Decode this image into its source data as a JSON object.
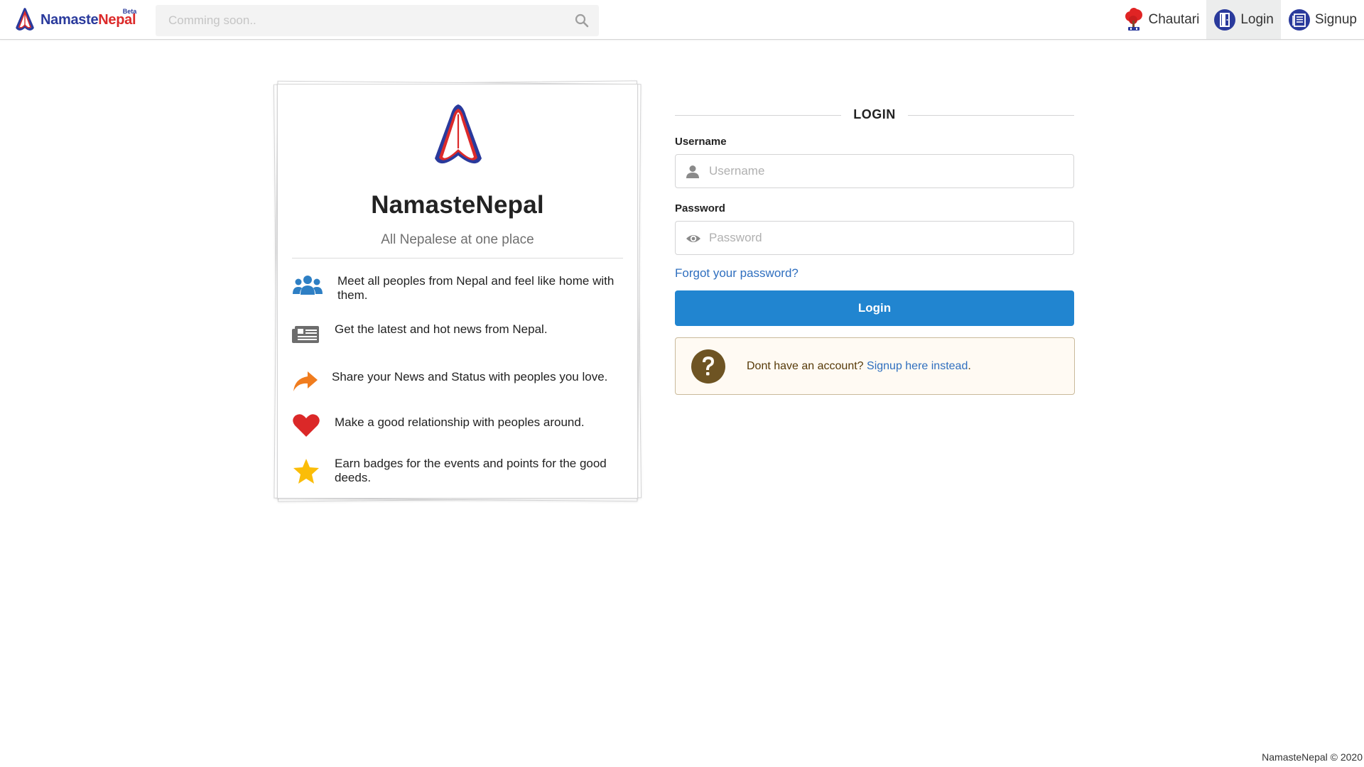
{
  "header": {
    "brand_part1": "Namaste",
    "brand_part2": "Nepal",
    "brand_badge": "Beta",
    "search_placeholder": "Comming soon..",
    "nav": [
      {
        "label": "Chautari",
        "icon": "tree-icon"
      },
      {
        "label": "Login",
        "icon": "door-icon",
        "active": true
      },
      {
        "label": "Signup",
        "icon": "signup-form-icon"
      }
    ]
  },
  "card": {
    "title": "NamasteNepal",
    "subtitle": "All Nepalese at one place",
    "features": [
      {
        "icon": "users-icon",
        "text": "Meet all peoples from Nepal and feel like home with them.",
        "color": "#2e7fc4"
      },
      {
        "icon": "newspaper-icon",
        "text": "Get the latest and hot news from Nepal.",
        "color": "#6d6d6d"
      },
      {
        "icon": "share-arrow-icon",
        "text": "Share your News and Status with peoples you love.",
        "color": "#f07c1e"
      },
      {
        "icon": "heart-icon",
        "text": "Make a good relationship with peoples around.",
        "color": "#db2828"
      },
      {
        "icon": "star-icon",
        "text": "Earn badges for the events and points for the good deeds.",
        "color": "#fbbd08"
      }
    ]
  },
  "login": {
    "heading": "LOGIN",
    "username_label": "Username",
    "username_placeholder": "Username",
    "password_label": "Password",
    "password_placeholder": "Password",
    "forgot_link": "Forgot your password?",
    "submit_label": "Login",
    "signup_prompt": "Dont have an account? ",
    "signup_link": "Signup here instead",
    "signup_suffix": "."
  },
  "footer": {
    "copyright": "NamasteNepal © 2020"
  },
  "colors": {
    "primary": "#2185d0",
    "brand_blue": "#2a3a9c",
    "brand_red": "#dc2a2a",
    "warning_bg": "#fffaf3"
  }
}
